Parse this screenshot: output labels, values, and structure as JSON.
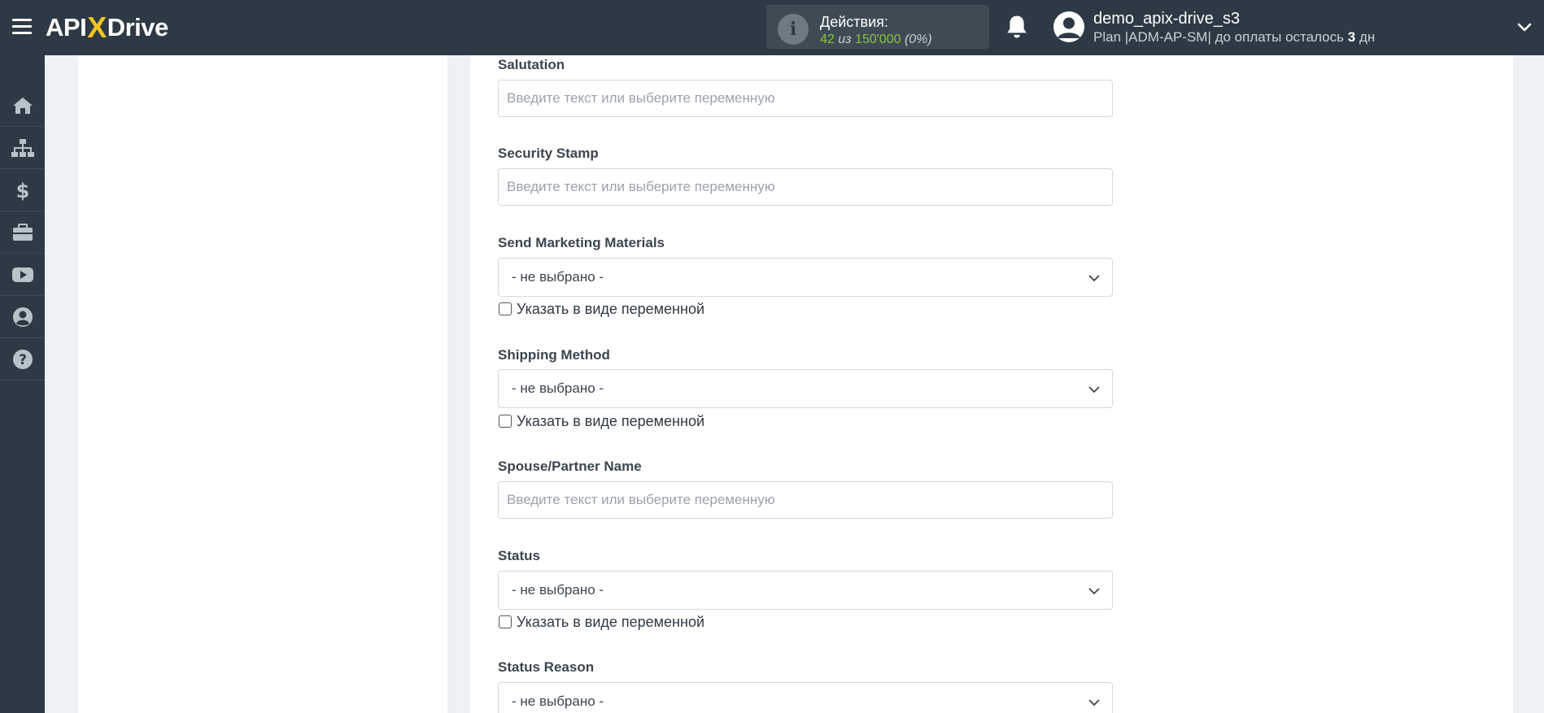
{
  "header": {
    "logo_left": "API",
    "logo_x": "X",
    "logo_right": "Drive",
    "actions_title": "Действия:",
    "actions_used": "42",
    "actions_of": "из",
    "actions_total": "150'000",
    "actions_percent": "(0%)",
    "username": "demo_apix-drive_s3",
    "plan_prefix": "Plan |ADM-AP-SM| до оплаты осталось",
    "plan_days": "3",
    "plan_suffix": "дн"
  },
  "sidebar": {
    "items": [
      {
        "icon": "home-icon"
      },
      {
        "icon": "sitemap-icon"
      },
      {
        "icon": "dollar-icon"
      },
      {
        "icon": "briefcase-icon"
      },
      {
        "icon": "youtube-icon"
      },
      {
        "icon": "user-circle-icon"
      },
      {
        "icon": "help-icon"
      }
    ]
  },
  "form": {
    "placeholder": "Введите текст или выберите переменную",
    "select_default": "- не выбрано -",
    "as_variable_label": "Указать в виде переменной",
    "fields": {
      "salutation": "Salutation",
      "security_stamp": "Security Stamp",
      "send_marketing": "Send Marketing Materials",
      "shipping_method": "Shipping Method",
      "spouse_name": "Spouse/Partner Name",
      "status": "Status",
      "status_reason": "Status Reason"
    }
  },
  "colors": {
    "topbar": "#2d3a45",
    "accent_green": "#8ac43f",
    "logo_x": "#f7c51b"
  }
}
